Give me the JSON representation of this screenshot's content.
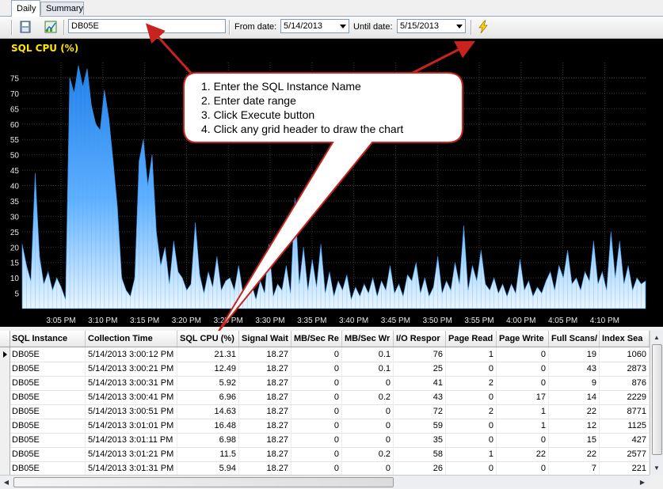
{
  "tabs": [
    {
      "label": "Daily",
      "active": true
    },
    {
      "label": "Summary",
      "active": false
    }
  ],
  "toolbar": {
    "instance_value": "DB05E",
    "from_label": "From date:",
    "from_value": "5/14/2013",
    "until_label": "Until date:",
    "until_value": "5/15/2013",
    "icons": [
      "save-icon",
      "chart-icon",
      "execute-lightning-icon"
    ]
  },
  "callout": {
    "lines": [
      "1. Enter the SQL Instance Name",
      "2. Enter date range",
      "3. Click Execute button",
      "4. Click any grid header to draw the chart"
    ]
  },
  "colors": {
    "chart_bg": "#000000",
    "title_color": "#ffe600",
    "series_color": "#2f8fe8",
    "arrow_color": "#c8231e"
  },
  "chart_data": {
    "type": "area",
    "title": "SQL CPU (%)",
    "yticks": [
      5,
      10,
      15,
      20,
      25,
      30,
      35,
      40,
      45,
      50,
      55,
      60,
      65,
      70,
      75
    ],
    "xticks": [
      "3:05 PM",
      "3:10 PM",
      "3:15 PM",
      "3:20 PM",
      "3:25 PM",
      "3:30 PM",
      "3:35 PM",
      "3:40 PM",
      "3:45 PM",
      "3:50 PM",
      "3:55 PM",
      "4:00 PM",
      "4:05 PM",
      "4:10 PM"
    ],
    "ylim": [
      0,
      80
    ],
    "xlim_minutes": [
      0,
      72
    ],
    "grid": true,
    "series": [
      {
        "values": [
          [
            0,
            21
          ],
          [
            0.5,
            14
          ],
          [
            1,
            9
          ],
          [
            1.5,
            44
          ],
          [
            2,
            17
          ],
          [
            2.5,
            8
          ],
          [
            3,
            12
          ],
          [
            3.5,
            6
          ],
          [
            4,
            10
          ],
          [
            4.5,
            7
          ],
          [
            5,
            3
          ],
          [
            5.5,
            75
          ],
          [
            6,
            70
          ],
          [
            6.5,
            79
          ],
          [
            7,
            72
          ],
          [
            7.5,
            78
          ],
          [
            8,
            66
          ],
          [
            8.5,
            60
          ],
          [
            9,
            58
          ],
          [
            9.5,
            71
          ],
          [
            10,
            62
          ],
          [
            10.5,
            48
          ],
          [
            11,
            33
          ],
          [
            11.5,
            10
          ],
          [
            12,
            6
          ],
          [
            12.5,
            4
          ],
          [
            13,
            10
          ],
          [
            13.5,
            48
          ],
          [
            14,
            55
          ],
          [
            14.5,
            40
          ],
          [
            15,
            50
          ],
          [
            15.5,
            25
          ],
          [
            16,
            14
          ],
          [
            16.5,
            20
          ],
          [
            17,
            8
          ],
          [
            17.5,
            22
          ],
          [
            18,
            12
          ],
          [
            18.5,
            10
          ],
          [
            19,
            6
          ],
          [
            19.5,
            8
          ],
          [
            20,
            28
          ],
          [
            20.5,
            11
          ],
          [
            21,
            5
          ],
          [
            21.5,
            12
          ],
          [
            22,
            7
          ],
          [
            22.5,
            17
          ],
          [
            23,
            6
          ],
          [
            23.5,
            9
          ],
          [
            24,
            10
          ],
          [
            24.5,
            6
          ],
          [
            25,
            14
          ],
          [
            25.5,
            5
          ],
          [
            26,
            4
          ],
          [
            26.5,
            8
          ],
          [
            27,
            3
          ],
          [
            27.5,
            9
          ],
          [
            28,
            5
          ],
          [
            28.5,
            21
          ],
          [
            29,
            4
          ],
          [
            29.5,
            8
          ],
          [
            30,
            6
          ],
          [
            30.5,
            14
          ],
          [
            31,
            5
          ],
          [
            31.5,
            36
          ],
          [
            32,
            8
          ],
          [
            32.5,
            20
          ],
          [
            33,
            6
          ],
          [
            33.5,
            16
          ],
          [
            34,
            7
          ],
          [
            34.5,
            21
          ],
          [
            35,
            5
          ],
          [
            35.5,
            12
          ],
          [
            36,
            4
          ],
          [
            36.5,
            9
          ],
          [
            37,
            6
          ],
          [
            37.5,
            11
          ],
          [
            38,
            3
          ],
          [
            38.5,
            7
          ],
          [
            39,
            4
          ],
          [
            39.5,
            8
          ],
          [
            40,
            5
          ],
          [
            40.5,
            10
          ],
          [
            41,
            4
          ],
          [
            41.5,
            9
          ],
          [
            42,
            6
          ],
          [
            42.5,
            14
          ],
          [
            43,
            5
          ],
          [
            43.5,
            8
          ],
          [
            44,
            4
          ],
          [
            44.5,
            11
          ],
          [
            45,
            9
          ],
          [
            45.5,
            15
          ],
          [
            46,
            5
          ],
          [
            46.5,
            10
          ],
          [
            47,
            4
          ],
          [
            47.5,
            7
          ],
          [
            48,
            17
          ],
          [
            48.5,
            5
          ],
          [
            49,
            9
          ],
          [
            49.5,
            6
          ],
          [
            50,
            15
          ],
          [
            50.5,
            8
          ],
          [
            51,
            27
          ],
          [
            51.5,
            6
          ],
          [
            52,
            14
          ],
          [
            52.5,
            9
          ],
          [
            53,
            19
          ],
          [
            53.5,
            8
          ],
          [
            54,
            6
          ],
          [
            54.5,
            10
          ],
          [
            55,
            5
          ],
          [
            55.5,
            8
          ],
          [
            56,
            4
          ],
          [
            56.5,
            8
          ],
          [
            57,
            5
          ],
          [
            57.5,
            16
          ],
          [
            58,
            6
          ],
          [
            58.5,
            9
          ],
          [
            59,
            4
          ],
          [
            59.5,
            7
          ],
          [
            60,
            5
          ],
          [
            60.5,
            9
          ],
          [
            61,
            12
          ],
          [
            61.5,
            6
          ],
          [
            62,
            14
          ],
          [
            62.5,
            10
          ],
          [
            63,
            19
          ],
          [
            63.5,
            8
          ],
          [
            64,
            10
          ],
          [
            64.5,
            6
          ],
          [
            65,
            12
          ],
          [
            65.5,
            9
          ],
          [
            66,
            22
          ],
          [
            66.5,
            8
          ],
          [
            67,
            12
          ],
          [
            67.5,
            6
          ],
          [
            68,
            25
          ],
          [
            68.5,
            10
          ],
          [
            69,
            22
          ],
          [
            69.5,
            8
          ],
          [
            70,
            14
          ],
          [
            70.5,
            6
          ],
          [
            71,
            10
          ],
          [
            71.5,
            8
          ],
          [
            72,
            9
          ]
        ]
      }
    ]
  },
  "grid": {
    "columns": [
      "SQL Instance",
      "Collection Time",
      "SQL CPU (%)",
      "Signal Wait",
      "MB/Sec Re",
      "MB/Sec Wr",
      "I/O Respor",
      "Page Read",
      "Page Write",
      "Full Scans/",
      "Index Sea"
    ],
    "rows": [
      [
        "DB05E",
        "5/14/2013 3:00:12 PM",
        "21.31",
        "18.27",
        "0",
        "0.1",
        "76",
        "1",
        "0",
        "19",
        "1060"
      ],
      [
        "DB05E",
        "5/14/2013 3:00:21 PM",
        "12.49",
        "18.27",
        "0",
        "0.1",
        "25",
        "0",
        "0",
        "43",
        "2873"
      ],
      [
        "DB05E",
        "5/14/2013 3:00:31 PM",
        "5.92",
        "18.27",
        "0",
        "0",
        "41",
        "2",
        "0",
        "9",
        "876"
      ],
      [
        "DB05E",
        "5/14/2013 3:00:41 PM",
        "6.96",
        "18.27",
        "0",
        "0.2",
        "43",
        "0",
        "17",
        "14",
        "2229"
      ],
      [
        "DB05E",
        "5/14/2013 3:00:51 PM",
        "14.63",
        "18.27",
        "0",
        "0",
        "72",
        "2",
        "1",
        "22",
        "8771"
      ],
      [
        "DB05E",
        "5/14/2013 3:01:01 PM",
        "16.48",
        "18.27",
        "0",
        "0",
        "59",
        "0",
        "1",
        "12",
        "1125"
      ],
      [
        "DB05E",
        "5/14/2013 3:01:11 PM",
        "6.98",
        "18.27",
        "0",
        "0",
        "35",
        "0",
        "0",
        "15",
        "427"
      ],
      [
        "DB05E",
        "5/14/2013 3:01:21 PM",
        "11.5",
        "18.27",
        "0",
        "0.2",
        "58",
        "1",
        "22",
        "22",
        "2577"
      ],
      [
        "DB05E",
        "5/14/2013 3:01:31 PM",
        "5.94",
        "18.27",
        "0",
        "0",
        "26",
        "0",
        "0",
        "7",
        "221"
      ]
    ]
  }
}
